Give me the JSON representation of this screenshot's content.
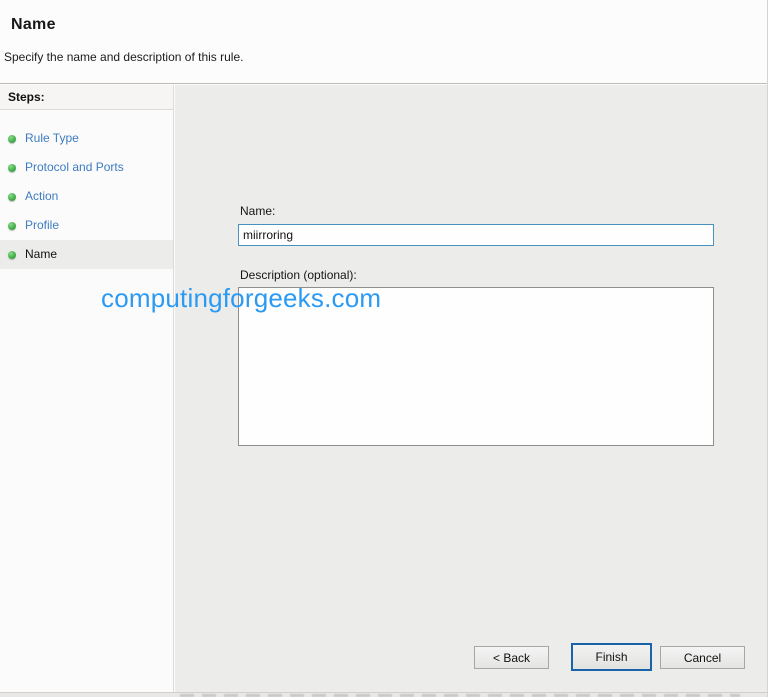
{
  "header": {
    "title": "Name",
    "subtitle": "Specify the name and description of this rule."
  },
  "sidebar": {
    "heading": "Steps:",
    "items": [
      {
        "label": "Rule Type",
        "state": "completed"
      },
      {
        "label": "Protocol and Ports",
        "state": "completed"
      },
      {
        "label": "Action",
        "state": "completed"
      },
      {
        "label": "Profile",
        "state": "completed"
      },
      {
        "label": "Name",
        "state": "current"
      }
    ]
  },
  "form": {
    "name_label": "Name:",
    "name_value": "miirroring",
    "description_label": "Description (optional):",
    "description_value": ""
  },
  "watermark": {
    "text": "computingforgeeks.com",
    "color": "#2b9af3"
  },
  "footer": {
    "back_label": "< Back",
    "finish_label": "Finish",
    "cancel_label": "Cancel"
  },
  "colors": {
    "step_link_blue": "#3c7cc0",
    "bullet_green": "#3fae49",
    "focused_input_border": "#4a90c2",
    "default_button_border": "#1a63a8",
    "content_background": "#ececeb"
  }
}
